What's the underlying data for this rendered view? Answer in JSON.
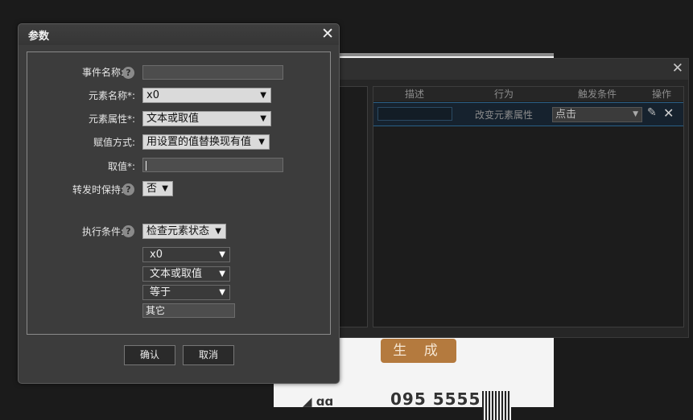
{
  "background": {
    "generate_label": "生 成",
    "phone_text": "095 5555",
    "interaction_table": {
      "headers": [
        "描述",
        "行为",
        "触发条件",
        "操作"
      ],
      "row": {
        "description": "",
        "action": "改变元素属性",
        "trigger": "点击"
      }
    }
  },
  "dialog": {
    "title": "参数",
    "fields": {
      "event_name": {
        "label": "事件名称:",
        "value": ""
      },
      "element_name": {
        "label": "元素名称*:",
        "value": "x0"
      },
      "element_attr": {
        "label": "元素属性*:",
        "value": "文本或取值"
      },
      "assign_method": {
        "label": "赋值方式:",
        "value": "用设置的值替换现有值"
      },
      "value": {
        "label": "取值*:",
        "value": ""
      },
      "keep_on_forward": {
        "label": "转发时保持:",
        "value": "否"
      },
      "exec_condition": {
        "label": "执行条件:",
        "value": "检查元素状态"
      }
    },
    "condition": {
      "element": "x0",
      "attribute": "文本或取值",
      "operator": "等于",
      "compare_value": "其它"
    },
    "buttons": {
      "confirm": "确认",
      "cancel": "取消"
    }
  }
}
